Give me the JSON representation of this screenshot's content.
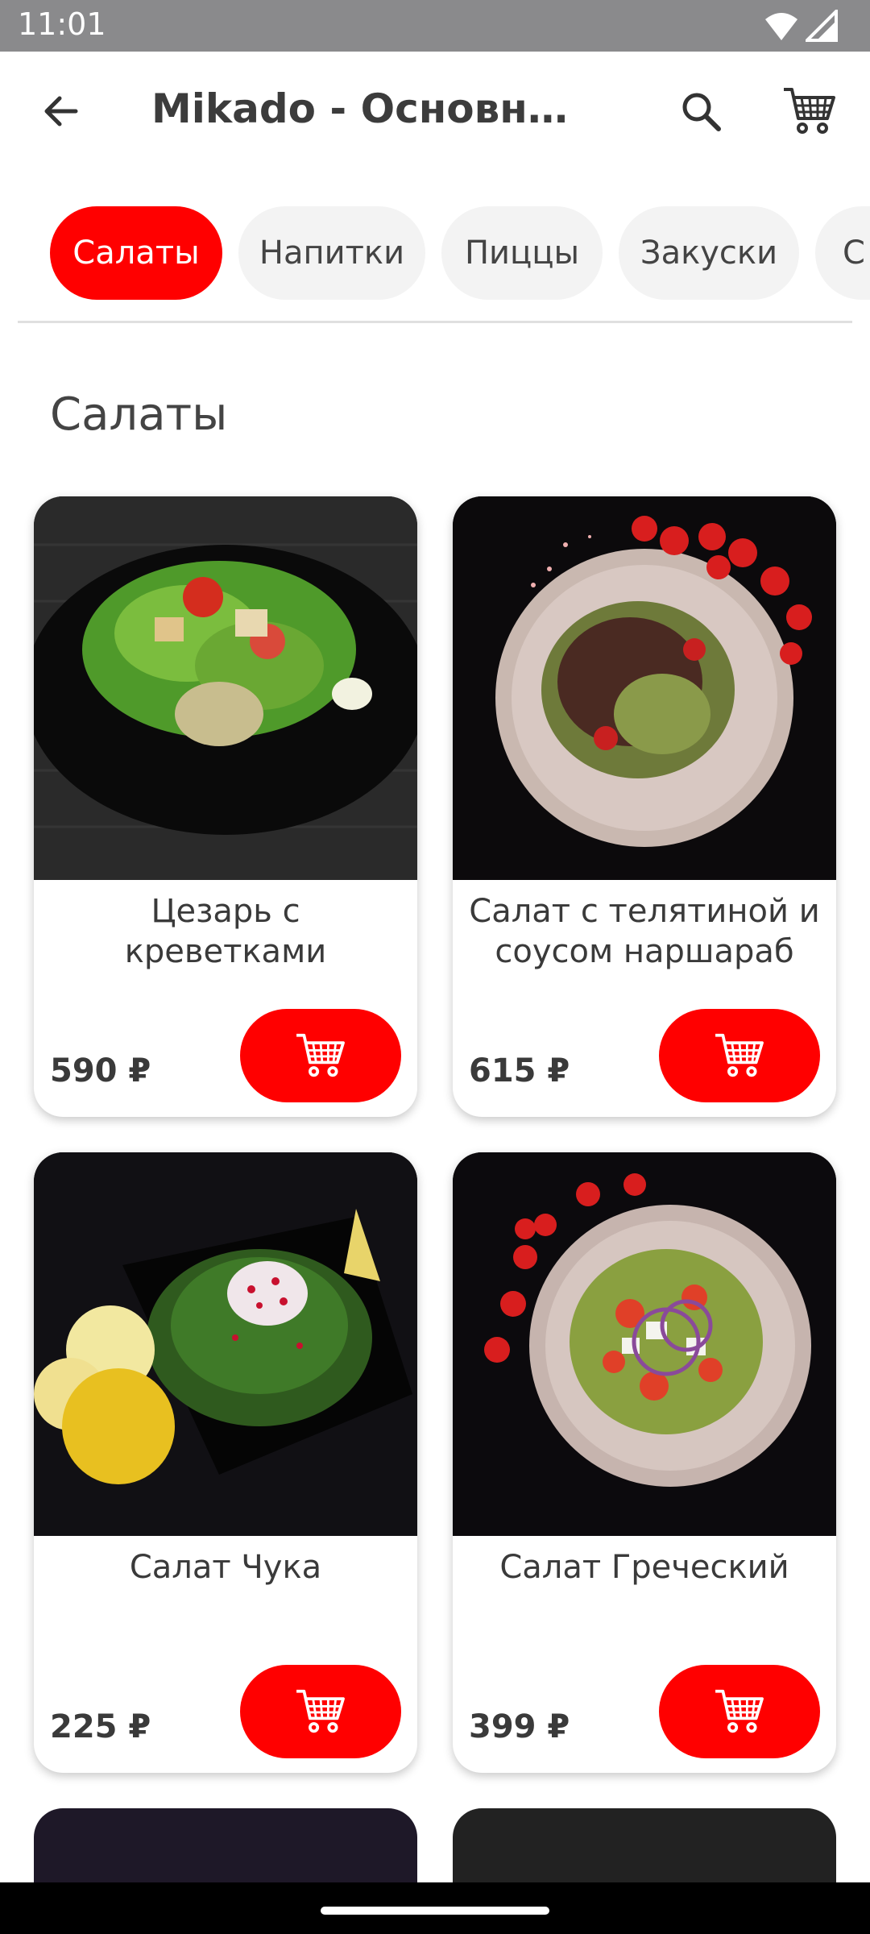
{
  "status_bar": {
    "time": "11:01",
    "icons": [
      "wifi-icon",
      "signal-icon"
    ]
  },
  "app_bar": {
    "title": "Mikado - Основной…",
    "back_icon": "arrow-left-icon",
    "search_icon": "search-icon",
    "cart_icon": "cart-icon"
  },
  "categories": [
    {
      "label": "Салаты",
      "active": true
    },
    {
      "label": "Напитки",
      "active": false
    },
    {
      "label": "Пиццы",
      "active": false
    },
    {
      "label": "Закуски",
      "active": false
    },
    {
      "label": "С",
      "active": false
    }
  ],
  "section": {
    "title": "Салаты"
  },
  "products": [
    {
      "name": "Цезарь с креветками",
      "price": "590 ₽"
    },
    {
      "name": "Салат с телятиной и соусом наршараб",
      "price": "615 ₽"
    },
    {
      "name": "Салат Чука",
      "price": "225 ₽"
    },
    {
      "name": "Салат Греческий",
      "price": "399 ₽"
    }
  ],
  "colors": {
    "accent": "#ff0000",
    "chip_bg": "#f3f3f3",
    "status_bar": "#8a8a8c"
  }
}
